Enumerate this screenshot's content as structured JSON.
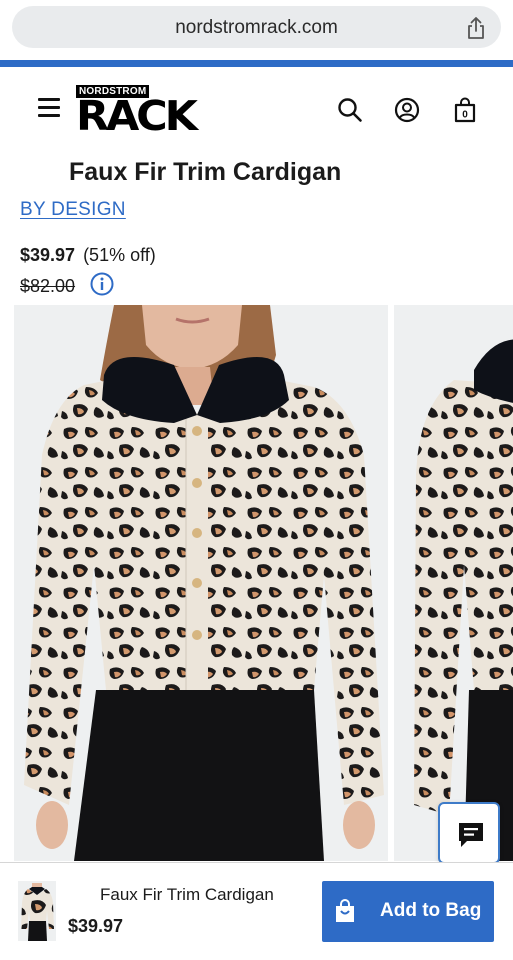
{
  "browser": {
    "url": "nordstromrack.com",
    "share_icon": "share-icon"
  },
  "header": {
    "menu_icon": "hamburger-menu-icon",
    "logo_top": "NORDSTROM",
    "logo_main": "RACK",
    "search_icon": "search-icon",
    "account_icon": "account-icon",
    "bag_icon": "shopping-bag-icon",
    "bag_count": "0"
  },
  "product": {
    "title": "Faux Fir Trim Cardigan",
    "brand": "BY DESIGN",
    "price": "$39.97",
    "discount": "(51% off)",
    "original_price": "$82.00",
    "info_icon": "info-icon"
  },
  "bottom_bar": {
    "title": "Faux Fir Trim Cardigan",
    "price": "$39.97",
    "add_to_bag_label": "Add to Bag"
  },
  "chat": {
    "icon": "chat-icon"
  },
  "colors": {
    "accent": "#2e6bc6",
    "url_pill": "#e9ebed"
  }
}
